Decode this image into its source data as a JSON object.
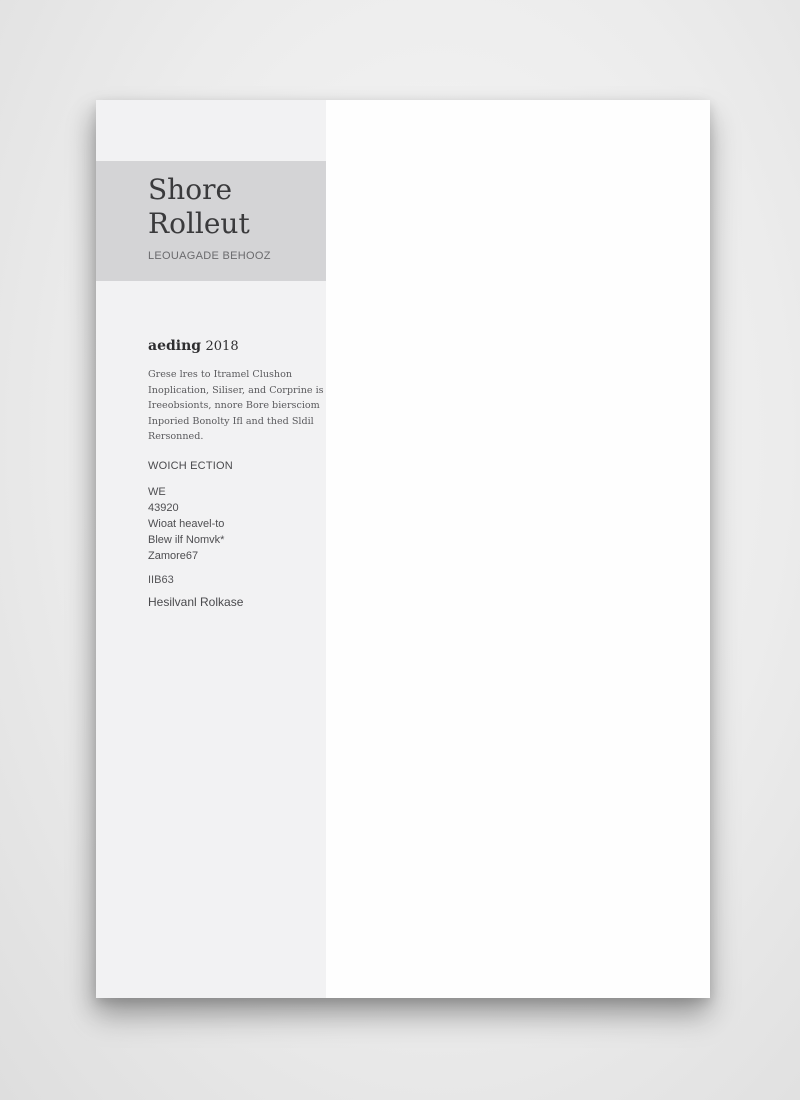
{
  "document": {
    "name_line1": "Shore",
    "name_line2": "Rolleut",
    "subtitle": "LEOUAGADE BEHOOZ",
    "section_heading_bold": "aeding",
    "section_heading_year": "2018",
    "body_lines": [
      "Grese lres to Itramel Clushon",
      "Inoplication, Siliser, and Corprine is",
      "Ireeobsionts, nnore Bore biersciom",
      "Inporied Bonolty Ifl and thed Sldil",
      "Rersonned."
    ],
    "contact_heading": "WOICH ECTION",
    "contact_lines": [
      "WE",
      "43920",
      "Wioat heavel-to",
      "Blew ilf Nomvk*",
      "Zamore67"
    ],
    "code": "IIB63",
    "footer": "Hesilvanl Rolkase"
  }
}
